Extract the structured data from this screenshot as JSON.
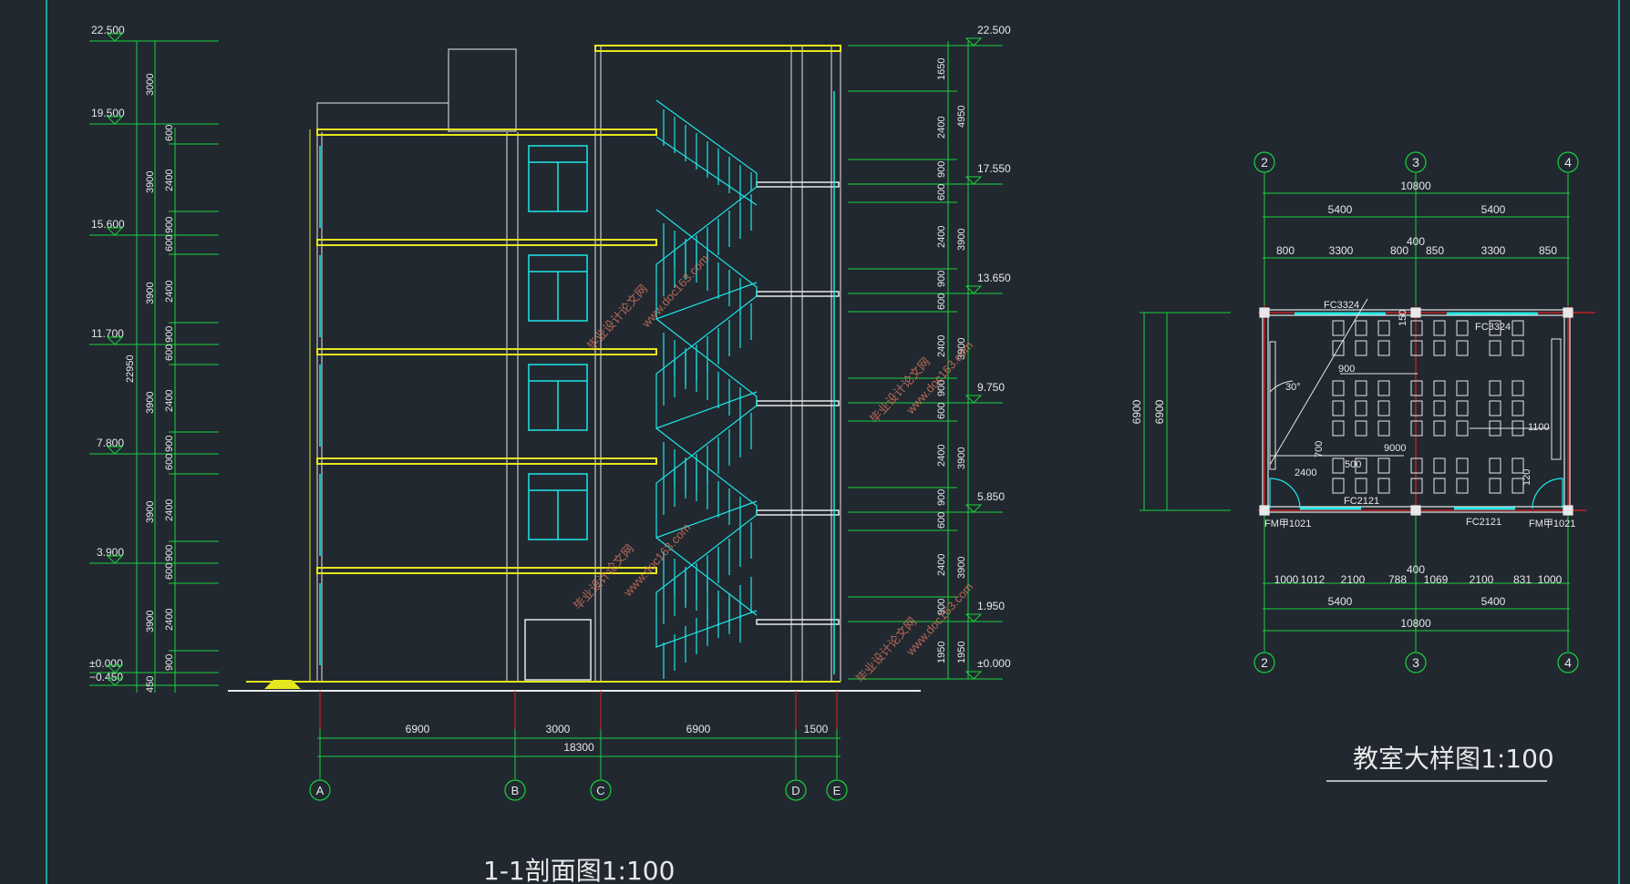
{
  "section": {
    "title": "1-1剖面图1:100",
    "left_elevations": [
      "22.500",
      "19.500",
      "15.600",
      "11.700",
      "7.800",
      "3.900",
      "±0.000",
      "−0.450"
    ],
    "right_elevations": [
      "22.500",
      "17.550",
      "13.650",
      "9.750",
      "5.850",
      "1.950",
      "±0.000"
    ],
    "left_total_dim": "22950",
    "left_dims_outer": [
      "3000",
      "3900",
      "3900",
      "3900",
      "3900",
      "3900",
      "450"
    ],
    "left_dims_inner": [
      "600",
      "2400",
      "900",
      "600",
      "2400",
      "900",
      "600",
      "2400",
      "900",
      "600",
      "2400",
      "900",
      "600",
      "2400",
      "900",
      "600",
      "2400",
      "900"
    ],
    "right_dims_outer": [
      "4950",
      "3900",
      "3900",
      "3900",
      "3900",
      "1950"
    ],
    "right_dims_inner": [
      "1650",
      "2400",
      "900",
      "600",
      "2400",
      "900",
      "600",
      "2400",
      "900",
      "600",
      "2400",
      "900",
      "600",
      "2400",
      "900",
      "1950"
    ],
    "axis_dims": [
      "6900",
      "3000",
      "6900",
      "1500"
    ],
    "axis_total": "18300",
    "axes": [
      "A",
      "B",
      "C",
      "D",
      "E"
    ],
    "watermarks": [
      "毕业设计论文网",
      "www.doc163.com"
    ]
  },
  "plan": {
    "title": "教室大样图1:100",
    "axes": [
      "2",
      "3",
      "4"
    ],
    "top_total": "10800",
    "top_halves": [
      "5400",
      "5400"
    ],
    "top_detail": [
      "800",
      "3300",
      "800",
      "400",
      "850",
      "3300",
      "850"
    ],
    "bottom_detail": [
      "1000",
      "1012",
      "2100",
      "788",
      "400",
      "1069",
      "2100",
      "831",
      "1000"
    ],
    "bottom_halves": [
      "5400",
      "5400"
    ],
    "bottom_total": "10800",
    "side_dims": [
      "6900",
      "6900"
    ],
    "windows_top": [
      "FC3324",
      "FC3324"
    ],
    "windows_bottom": [
      "FC2121",
      "FC2121"
    ],
    "doors": [
      "FM甲1021",
      "FM甲1021"
    ],
    "inner_dims": [
      "900",
      "9000",
      "1100",
      "2400",
      "500",
      "700",
      "150",
      "120",
      "30°"
    ]
  }
}
